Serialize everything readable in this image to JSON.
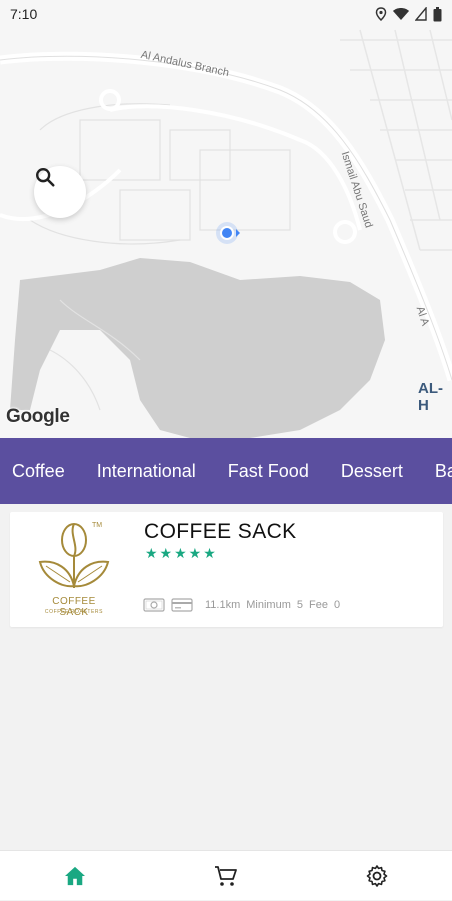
{
  "status": {
    "time": "7:10"
  },
  "map": {
    "labels": {
      "al_andalus": "Al Andalus Branch",
      "ismail": "Ismail Abu Saud",
      "al_a": "Al A",
      "al_h": "AL-H"
    },
    "google": "Google"
  },
  "categories": [
    "Coffee",
    "International",
    "Fast Food",
    "Dessert",
    "Ba"
  ],
  "store": {
    "name": "COFFEE SACK",
    "stars": "★★★★★",
    "rating_value": 5,
    "logo_text": "COFFEE SACK",
    "logo_subtext": "COFFEE ROASTERS",
    "logo_tm": "TM",
    "distance": "11.1km",
    "minimum_label": "Minimum",
    "minimum_value": "5",
    "fee_label": "Fee",
    "fee_value": "0"
  },
  "colors": {
    "accent": "#5b4f9f",
    "green": "#1aa882"
  },
  "nav": {
    "home_icon": "home-icon",
    "cart_icon": "cart-icon",
    "settings_icon": "gear-icon"
  }
}
